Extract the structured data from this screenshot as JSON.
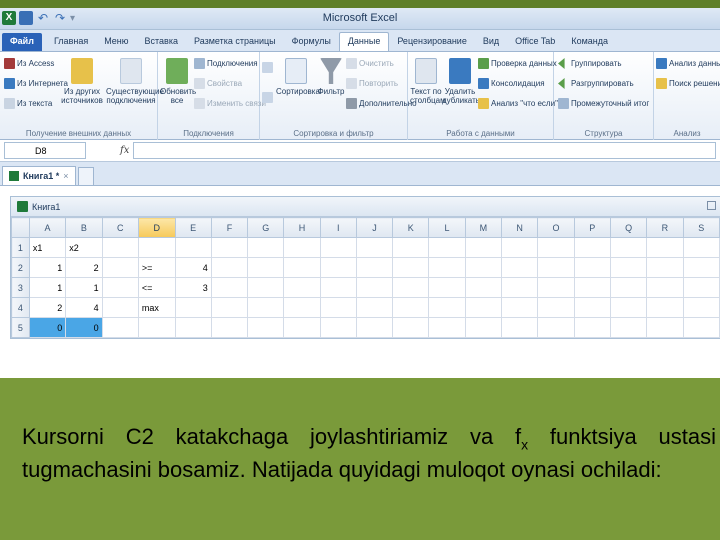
{
  "window": {
    "title": "Microsoft Excel"
  },
  "ribbon": {
    "tabs": [
      "Файл",
      "Главная",
      "Меню",
      "Вставка",
      "Разметка страницы",
      "Формулы",
      "Данные",
      "Рецензирование",
      "Вид",
      "Office Tab",
      "Команда"
    ],
    "active_tab": "Данные",
    "groups": {
      "external": {
        "name": "Получение внешних данных",
        "from_access": "Из Access",
        "from_web": "Из Интернета",
        "from_text": "Из текста",
        "other_sources": "Из других источников",
        "existing": "Существующие подключения"
      },
      "connections": {
        "name": "Подключения",
        "refresh_all": "Обновить все",
        "connections": "Подключения",
        "properties": "Свойства",
        "edit_links": "Изменить связи"
      },
      "sort_filter": {
        "name": "Сортировка и фильтр",
        "sort": "Сортировка",
        "filter": "Фильтр",
        "clear": "Очистить",
        "reapply": "Повторить",
        "advanced": "Дополнительно"
      },
      "data_tools": {
        "name": "Работа с данными",
        "text_to_columns": "Текст по столбцам",
        "remove_duplicates": "Удалить дубликаты",
        "validation": "Проверка данных",
        "consolidate": "Консолидация",
        "what_if": "Анализ \"что если\""
      },
      "outline": {
        "name": "Структура",
        "group": "Группировать",
        "ungroup": "Разгруппировать",
        "subtotal": "Промежуточный итог"
      },
      "analysis": {
        "name": "Анализ",
        "data_analysis": "Анализ данных",
        "solver": "Поиск решения"
      }
    }
  },
  "formula_bar": {
    "name_box": "D8",
    "fx": "fx",
    "formula": ""
  },
  "workbook": {
    "tab_label": "Книга1 *",
    "tab_close": "×",
    "inner_title": "Книга1"
  },
  "sheet": {
    "columns": [
      "A",
      "B",
      "C",
      "D",
      "E",
      "F",
      "G",
      "H",
      "I",
      "J",
      "K",
      "L",
      "M",
      "N",
      "O",
      "P",
      "Q",
      "R",
      "S"
    ],
    "selected_column": "D",
    "rows": [
      {
        "n": "1",
        "cells": [
          "x1",
          "x2",
          "",
          "",
          ""
        ]
      },
      {
        "n": "2",
        "cells": [
          "1",
          "2",
          "",
          ">=",
          "4"
        ]
      },
      {
        "n": "3",
        "cells": [
          "1",
          "1",
          "",
          "<=",
          "3"
        ]
      },
      {
        "n": "4",
        "cells": [
          "2",
          "4",
          "",
          "max",
          ""
        ]
      },
      {
        "n": "5",
        "cells": [
          "0",
          "0",
          "",
          "",
          ""
        ]
      }
    ]
  },
  "caption": {
    "part1": "Kursorni C2 katakchaga joylashtiriamiz va f",
    "sub": "x",
    "part2": " funktsiya ustasi  tugmachasini bosamiz. Natijada quyidagi muloqot oynasi ochiladi:"
  },
  "colors": {
    "background": "#7a9a3a",
    "selection": "#4aa6e6"
  }
}
